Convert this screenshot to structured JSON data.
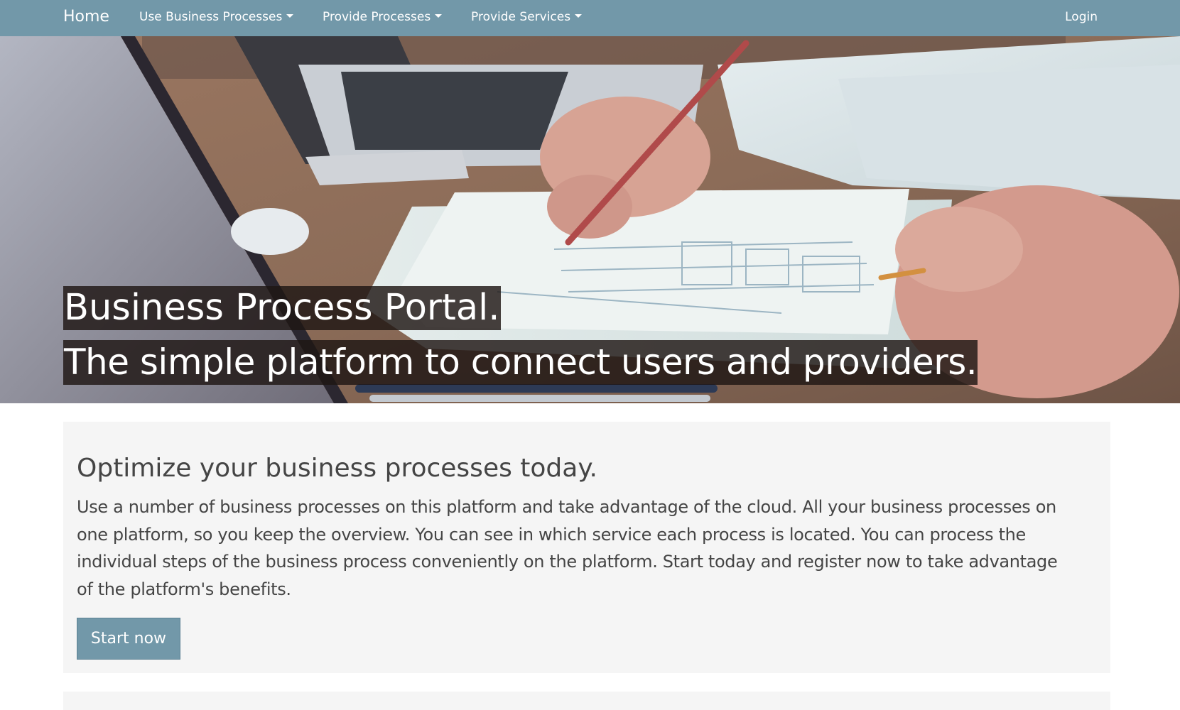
{
  "navbar": {
    "brand": "Home",
    "items": [
      {
        "label": "Use Business Processes"
      },
      {
        "label": "Provide Processes"
      },
      {
        "label": "Provide Services"
      }
    ],
    "login": "Login"
  },
  "hero": {
    "title": "Business Process Portal.",
    "subtitle": "The simple platform to connect users and providers."
  },
  "jumbotron": {
    "heading": "Optimize your business processes today.",
    "text": "Use a number of business processes on this platform and take advantage of the cloud. All your business processes on one platform, so you keep the overview. You can see in which service each process is located. You can process the individual steps of the business process conveniently on the platform. Start today and register now to take advantage of the platform's benefits.",
    "button": "Start now"
  },
  "colors": {
    "navbar": "#7298a9",
    "button": "#7298a9",
    "panel": "#f5f5f5",
    "text": "#454545"
  }
}
